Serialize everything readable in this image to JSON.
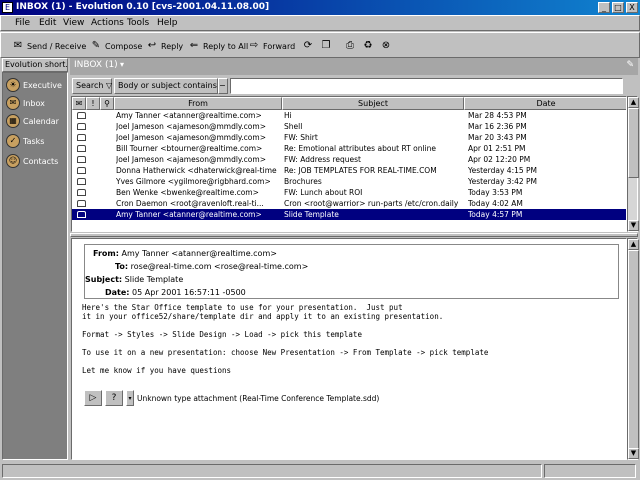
{
  "window": {
    "title": "INBOX (1) - Evolution 0.10 [cvs-2001.04.11.08.00]",
    "buttons": [
      "_",
      "□",
      "X"
    ]
  },
  "menu": [
    "File",
    "Edit",
    "View",
    "Actions",
    "Tools",
    "Help"
  ],
  "toolbar": [
    {
      "label": "Send / Receive",
      "icon": "send-receive-icon",
      "glyph": "✉"
    },
    {
      "label": "Compose",
      "icon": "compose-icon",
      "glyph": "✎"
    },
    {
      "label": "Reply",
      "icon": "reply-icon",
      "glyph": "↩"
    },
    {
      "label": "Reply to All",
      "icon": "reply-all-icon",
      "glyph": "⇐"
    },
    {
      "label": "Forward",
      "icon": "forward-icon",
      "glyph": "⇨"
    },
    {
      "label": "",
      "icon": "move-icon",
      "glyph": "⟳"
    },
    {
      "label": "",
      "icon": "copy-icon",
      "glyph": "❐"
    },
    {
      "label": "",
      "icon": "print-icon",
      "glyph": "⎙"
    },
    {
      "label": "",
      "icon": "delete-icon",
      "glyph": "♻"
    },
    {
      "label": "",
      "icon": "stop-icon",
      "glyph": "⊗"
    }
  ],
  "sidebar": {
    "header": "Evolution short...",
    "items": [
      {
        "label": "Executive",
        "icon": "summary-icon"
      },
      {
        "label": "Inbox",
        "icon": "inbox-icon"
      },
      {
        "label": "Calendar",
        "icon": "calendar-icon"
      },
      {
        "label": "Tasks",
        "icon": "tasks-icon"
      },
      {
        "label": "Contacts",
        "icon": "contacts-icon"
      }
    ]
  },
  "folder": {
    "name": "INBOX (1)"
  },
  "search": {
    "button": "Search ▽",
    "field_menu": "Body or subject contains",
    "field_value": ""
  },
  "columns": [
    "From",
    "Subject",
    "Date"
  ],
  "messages": [
    {
      "from": "Amy Tanner <atanner@realtime.com>",
      "subject": "Hi",
      "date": "Mar 28 4:53 PM",
      "selected": false
    },
    {
      "from": "Joel Jameson <ajameson@mmdly.com>",
      "subject": "Shell",
      "date": "Mar 16 2:36 PM",
      "selected": false
    },
    {
      "from": "Joel Jameson <ajameson@mmdly.com>",
      "subject": "FW: Shirt",
      "date": "Mar 20 3:43 PM",
      "selected": false
    },
    {
      "from": "Bill Tourner <btourner@realtime.com>",
      "subject": "Re: Emotional attributes about RT online",
      "date": "Apr 01 2:51 PM",
      "selected": false
    },
    {
      "from": "Joel Jameson <ajameson@mmdly.com>",
      "subject": "FW: Address request",
      "date": "Apr 02 12:20 PM",
      "selected": false
    },
    {
      "from": "Donna Hatherwick <dhaterwick@real-time",
      "subject": "Re: JOB TEMPLATES FOR REAL-TIME.COM",
      "date": "Yesterday 4:15 PM",
      "selected": false
    },
    {
      "from": "Yves Gilmore <ygilmore@rigbhard.com>",
      "subject": "Brochures",
      "date": "Yesterday 3:42 PM",
      "selected": false
    },
    {
      "from": "Ben Wenke <bwenke@realtime.com>",
      "subject": "FW: Lunch about ROI",
      "date": "Today 3:53 PM",
      "selected": false
    },
    {
      "from": "Cron Daemon <root@ravenloft.real-ti...",
      "subject": "Cron <root@warrior> run-parts /etc/cron.daily",
      "date": "Today 4:02 AM",
      "selected": false
    },
    {
      "from": "Amy Tanner <atanner@realtime.com>",
      "subject": "Slide Template",
      "date": "Today 4:57 PM",
      "selected": true
    }
  ],
  "preview": {
    "from_label": "From:",
    "from": "Amy Tanner <atanner@realtime.com>",
    "to_label": "To:",
    "to": "rose@real-time.com <rose@real-time.com>",
    "subject_label": "Subject:",
    "subject": "Slide Template",
    "date_label": "Date:",
    "date": "05 Apr 2001 16:57:11 -0500",
    "body": [
      "Here's the Star Office template to use for your presentation.  Just put",
      "it in your office52/share/template dir and apply it to an existing presentation.",
      "",
      "Format -> Styles -> Slide Design -> Load -> pick this template",
      "",
      "To use it on a new presentation: choose New Presentation -> From Template -> pick template",
      "",
      "Let me know if you have questions"
    ],
    "attachment": "Unknown type attachment (Real-Time Conference Template.sdd)"
  },
  "colors": {
    "selection": "#000080",
    "sidebar_bg": "#7f7f7f",
    "folderbar_bg": "#a6a6a6"
  }
}
